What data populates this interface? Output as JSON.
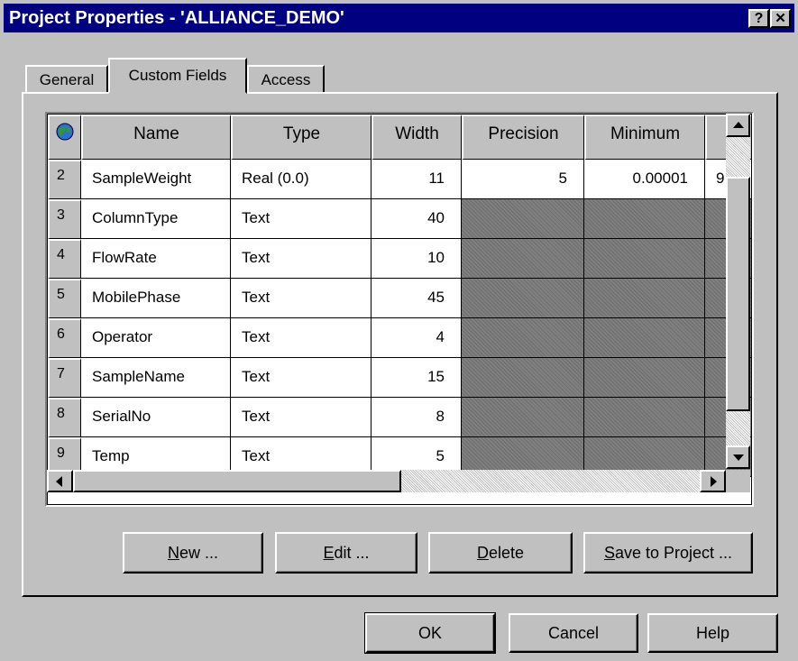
{
  "window": {
    "title": "Project Properties - 'ALLIANCE_DEMO'",
    "help_btn": "?",
    "close_btn": "✕"
  },
  "tabs": [
    {
      "label": "General"
    },
    {
      "label": "Custom Fields",
      "active": true
    },
    {
      "label": "Access"
    }
  ],
  "grid": {
    "columns": [
      "Name",
      "Type",
      "Width",
      "Precision",
      "Minimum"
    ],
    "rows": [
      {
        "num": "2",
        "name": "SampleWeight",
        "type": "Real (0.0)",
        "width": "11",
        "precision": "5",
        "minimum": "0.00001",
        "extra": "9"
      },
      {
        "num": "3",
        "name": "ColumnType",
        "type": "Text",
        "width": "40"
      },
      {
        "num": "4",
        "name": "FlowRate",
        "type": "Text",
        "width": "10"
      },
      {
        "num": "5",
        "name": "MobilePhase",
        "type": "Text",
        "width": "45"
      },
      {
        "num": "6",
        "name": "Operator",
        "type": "Text",
        "width": "4"
      },
      {
        "num": "7",
        "name": "SampleName",
        "type": "Text",
        "width": "15"
      },
      {
        "num": "8",
        "name": "SerialNo",
        "type": "Text",
        "width": "8"
      },
      {
        "num": "9",
        "name": "Temp",
        "type": "Text",
        "width": "5"
      }
    ]
  },
  "buttons": {
    "new": {
      "u": "N",
      "rest": "ew ..."
    },
    "edit": {
      "u": "E",
      "rest": "dit ..."
    },
    "delete": {
      "u": "D",
      "rest": "elete"
    },
    "save": {
      "u": "S",
      "rest": "ave to Project ..."
    }
  },
  "footer": {
    "ok": "OK",
    "cancel": "Cancel",
    "help": "Help"
  },
  "colors": {
    "titlebar": "#000080",
    "face": "#c0c0c0",
    "disabled_cell": "#808080"
  }
}
